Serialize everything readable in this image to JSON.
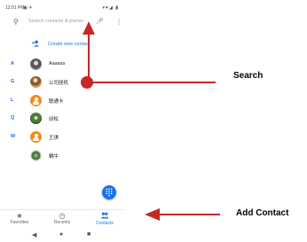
{
  "status_bar": {
    "time": "12:01 PM",
    "left_icons": "▣ ✈",
    "right_icons": "▾♥◢ ▮"
  },
  "search": {
    "placeholder": "Search contacts & places",
    "search_icon": "search-icon",
    "mic_icon": "mic-icon",
    "more_icon": "more-vert-icon"
  },
  "create_contact": {
    "label": "Create new contact",
    "icon": "add-person-icon"
  },
  "contacts": [
    {
      "letter": "A",
      "name": "Aaaass"
    },
    {
      "letter": "G",
      "name": "公司座机"
    },
    {
      "letter": "L",
      "name": "联通卡"
    },
    {
      "letter": "Q",
      "name": "邱松"
    },
    {
      "letter": "W",
      "name": "王琪"
    },
    {
      "letter": "",
      "name": "蜗牛"
    }
  ],
  "fab": {
    "icon": "dialpad-icon"
  },
  "bottom_nav": [
    {
      "label": "Favorites",
      "icon": "star-icon",
      "active": false
    },
    {
      "label": "Recents",
      "icon": "clock-icon",
      "active": false
    },
    {
      "label": "Contacts",
      "icon": "people-icon",
      "active": true
    }
  ],
  "annotations": {
    "search": "Search",
    "add_contact": "Add Contact"
  },
  "colors": {
    "accent": "#1a73e8",
    "arrow": "#c62828",
    "avatar_orange": "#f28b22"
  }
}
